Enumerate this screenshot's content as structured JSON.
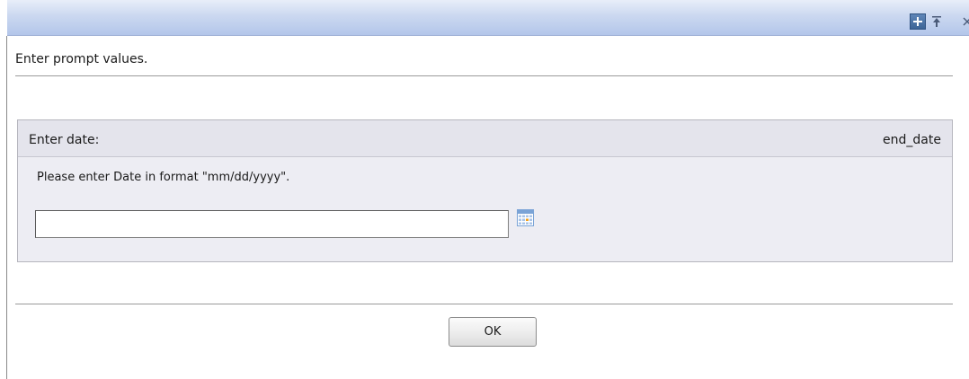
{
  "dialog": {
    "header_text": "Enter prompt values."
  },
  "titlebar": {
    "icons": [
      "expand-icon",
      "pin-icon",
      "close-icon"
    ]
  },
  "prompt": {
    "label": "Enter date:",
    "parameter_name": "end_date",
    "instruction": "Please enter Date in format \"mm/dd/yyyy\".",
    "date_value": "",
    "calendar_icon": "calendar-icon"
  },
  "footer": {
    "ok_label": "OK"
  },
  "colors": {
    "titlebar_accent": "#b3c6ea",
    "panel_background": "#ededf3",
    "panel_header_background": "#e4e4ec"
  }
}
